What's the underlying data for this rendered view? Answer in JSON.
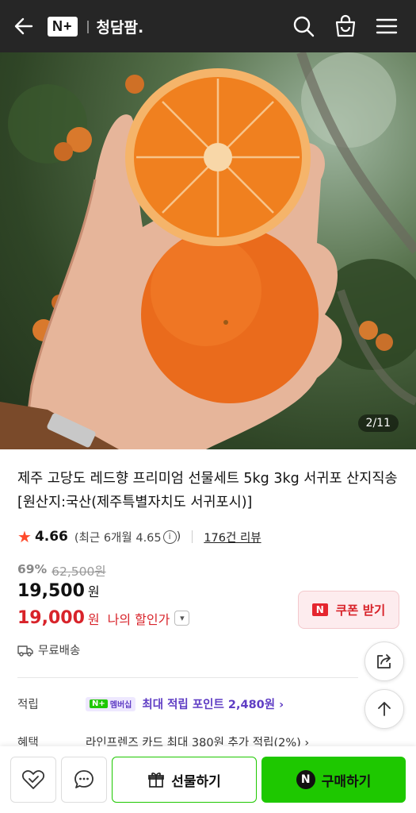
{
  "header": {
    "logo_text": "N+",
    "store_name": "청담팜."
  },
  "hero": {
    "counter": "2/11"
  },
  "product": {
    "title": "제주 고당도 레드향 프리미엄 선물세트 5kg 3kg 서귀포 산지직송 [원산지:국산(제주특별자치도 서귀포시)]",
    "rating": "4.66",
    "recent_rating": "(최근 6개월 4.65",
    "reviews": "176건 리뷰",
    "discount": "69%",
    "original_price": "62,500원",
    "price": "19,500",
    "price_unit": "원",
    "my_price": "19,000",
    "my_price_unit": "원",
    "my_price_label": "나의 할인가"
  },
  "coupon": {
    "badge": "N",
    "label": "쿠폰 받기"
  },
  "shipping": {
    "label": "무료배송"
  },
  "points": {
    "label": "적립",
    "badge_n": "N+",
    "badge_text": "멤버십",
    "text": "최대 적립 포인트 2,480원 ›"
  },
  "benefit": {
    "label": "혜택",
    "text": "라인프렌즈 카드 최대 380원 추가 적립(2%) ›"
  },
  "bottom": {
    "gift_label": "선물하기",
    "buy_badge": "N",
    "buy_label": "구매하기"
  },
  "colors": {
    "header_bg": "#262626",
    "naver_green": "#1ec800",
    "sale_red": "#d8232a",
    "star": "#ff4a2b",
    "membership_purple": "#5f3dc4"
  }
}
